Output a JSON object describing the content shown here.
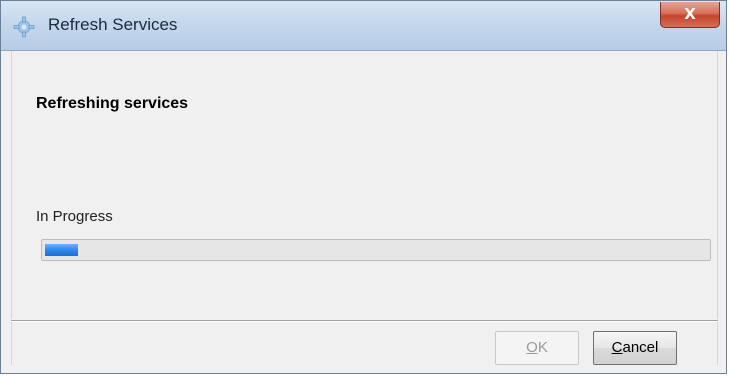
{
  "window": {
    "title": "Refresh Services",
    "close_glyph": "X",
    "app_icon": "gear-icon"
  },
  "content": {
    "heading": "Refreshing services",
    "status": "In Progress"
  },
  "progress": {
    "fraction": 0.05,
    "fill_color": "#2f86ea"
  },
  "buttons": {
    "ok": {
      "mnemonic": "O",
      "rest": "K",
      "enabled": false
    },
    "cancel": {
      "mnemonic": "C",
      "rest": "ancel",
      "enabled": true
    }
  }
}
